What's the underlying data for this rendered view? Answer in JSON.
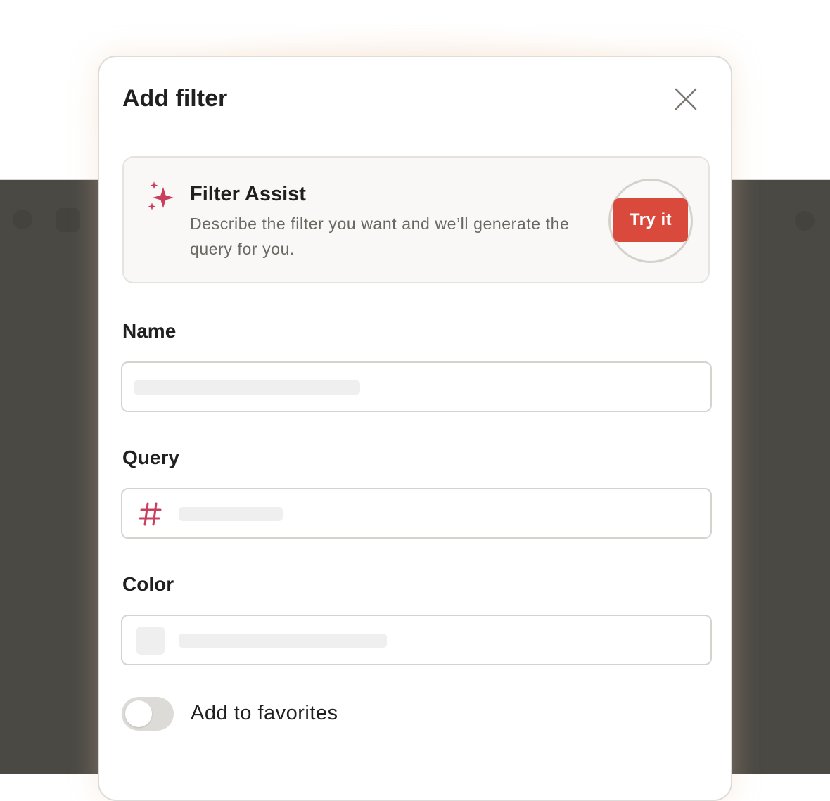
{
  "dialog": {
    "title": "Add filter",
    "close_icon": "close-icon"
  },
  "assist": {
    "icon": "sparkle-icon",
    "title": "Filter Assist",
    "description": "Describe the filter you want and we’ll generate the query for you.",
    "button_label": "Try it",
    "accent_color": "#d9493c",
    "icon_color": "#c8405e"
  },
  "fields": {
    "name_label": "Name",
    "query_label": "Query",
    "query_icon": "hash-icon",
    "color_label": "Color"
  },
  "favorites": {
    "label": "Add to favorites",
    "enabled": false
  }
}
